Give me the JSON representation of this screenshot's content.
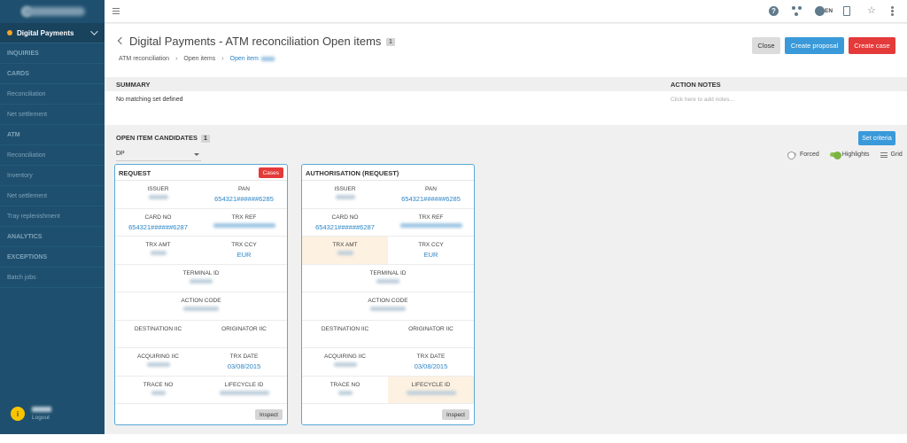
{
  "sidebar": {
    "active_item": "Digital Payments",
    "items": [
      {
        "label": "INQUIRIES",
        "caps": true
      },
      {
        "label": "CARDS",
        "caps": true
      },
      {
        "label": "Reconciliation",
        "caps": false
      },
      {
        "label": "Net settlement",
        "caps": false
      },
      {
        "label": "ATM",
        "caps": true
      },
      {
        "label": "Reconciliation",
        "caps": false
      },
      {
        "label": "Inventory",
        "caps": false
      },
      {
        "label": "Net settlement",
        "caps": false
      },
      {
        "label": "Tray replenishment",
        "caps": false
      },
      {
        "label": "ANALYTICS",
        "caps": true
      },
      {
        "label": "EXCEPTIONS",
        "caps": true
      },
      {
        "label": "Batch jobs",
        "caps": false
      }
    ],
    "user_initial": "i",
    "logout_label": "Logout"
  },
  "topbar": {
    "language": "EN",
    "help_glyph": "?",
    "star_glyph": "☆",
    "icons": [
      "menu-icon",
      "help-icon",
      "network-icon",
      "globe-icon",
      "document-icon",
      "star-icon",
      "kebab-menu-icon"
    ]
  },
  "header": {
    "title": "Digital Payments - ATM reconciliation Open items",
    "title_count": "1",
    "breadcrumb": [
      "ATM reconciliation",
      "Open items",
      "Open item"
    ],
    "close_label": "Close",
    "proposal_label": "Create proposal",
    "case_label": "Create case"
  },
  "summary": {
    "summary_heading": "SUMMARY",
    "notes_heading": "ACTION NOTES",
    "no_set_text": "No matching set defined",
    "notes_placeholder": "Click here to add notes..."
  },
  "candidates": {
    "heading": "OPEN ITEM CANDIDATES",
    "count": "1",
    "criteria_label": "Set criteria",
    "select_value": "DP",
    "toggles": {
      "forced": "Forced",
      "highlights": "Highlights",
      "grid": "Grid"
    },
    "cards": [
      {
        "title": "REQUEST",
        "cases_label": "Cases",
        "inspect_label": "Inspect",
        "pan": "654321######6285",
        "card_no": "654321######6287",
        "trx_ccy": "EUR",
        "trx_date": "03/08/2015"
      },
      {
        "title": "AUTHORISATION (REQUEST)",
        "inspect_label": "Inspect",
        "pan": "654321######6285",
        "card_no": "654321######6287",
        "trx_ccy": "EUR",
        "trx_date": "03/08/2015"
      }
    ],
    "labels": {
      "issuer": "ISSUER",
      "pan": "PAN",
      "card_no": "CARD NO",
      "trx_ref": "TRX REF",
      "trx_amt": "TRX AMT",
      "trx_ccy": "TRX CCY",
      "terminal_id": "TERMINAL ID",
      "action_code": "ACTION CODE",
      "destination_iic": "DESTINATION IIC",
      "originator_iic": "ORIGINATOR IIC",
      "acquiring_iic": "ACQUIRING IIC",
      "trx_date": "TRX DATE",
      "trace_no": "TRACE NO",
      "lifecycle_id": "LIFECYCLE ID"
    }
  },
  "colors": {
    "sidebar_bg": "#1e4f6e",
    "accent_blue": "#3a9ad9",
    "danger_red": "#e43a3a",
    "highlight": "#fdf1e1"
  }
}
